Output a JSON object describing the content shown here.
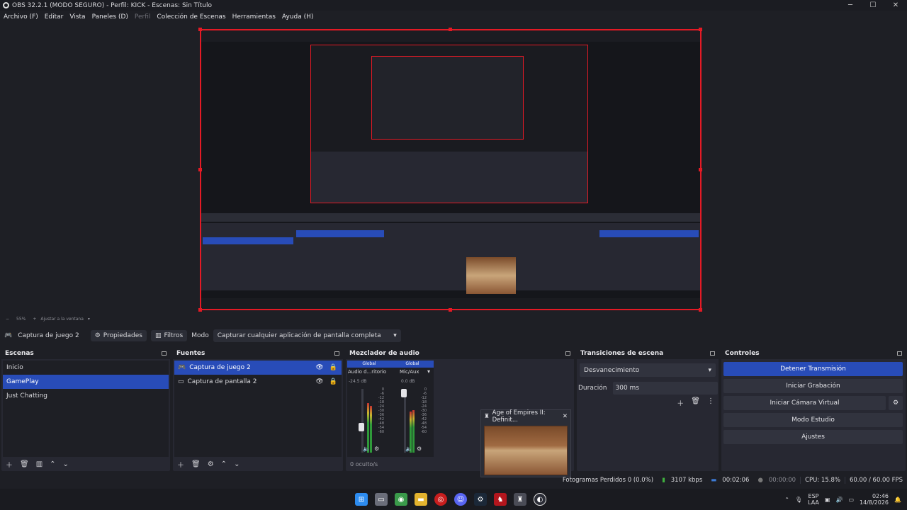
{
  "window": {
    "title": "OBS 32.2.1 (MODO SEGURO) - Perfil: KICK - Escenas: Sin Título",
    "minimize": "─",
    "maximize": "☐",
    "close": "✕"
  },
  "menu": [
    {
      "label": "Archivo (F)",
      "enabled": true
    },
    {
      "label": "Editar",
      "enabled": true
    },
    {
      "label": "Vista",
      "enabled": true
    },
    {
      "label": "Paneles (D)",
      "enabled": true
    },
    {
      "label": "Perfil",
      "enabled": false
    },
    {
      "label": "Colección de Escenas",
      "enabled": true
    },
    {
      "label": "Herramientas",
      "enabled": true
    },
    {
      "label": "Ayuda (H)",
      "enabled": true
    }
  ],
  "zoom": {
    "minus": "−",
    "value": "55%",
    "plus": "+",
    "fit": "Ajustar a la ventana"
  },
  "context": {
    "source_name": "Captura de juego 2",
    "properties": "Propiedades",
    "filters": "Filtros",
    "mode_label": "Modo",
    "mode_value": "Capturar cualquier aplicación de pantalla completa"
  },
  "scenes": {
    "title": "Escenas",
    "items": [
      {
        "label": "Inicio",
        "selected": false
      },
      {
        "label": "GamePlay",
        "selected": true
      },
      {
        "label": "Just Chatting",
        "selected": false
      }
    ]
  },
  "sources": {
    "title": "Fuentes",
    "items": [
      {
        "label": "Captura de juego 2",
        "selected": true
      },
      {
        "label": "Captura de pantalla 2",
        "selected": false
      }
    ]
  },
  "mixer": {
    "title": "Mezclador de audio",
    "channels": [
      {
        "tag": "Global",
        "name": "Audio d...ritorio",
        "db": "-24.5 dB",
        "level": 0.55
      },
      {
        "tag": "Global",
        "name": "Mic/Aux",
        "db": "0.0 dB",
        "level": 0.5
      }
    ],
    "ticks": [
      "0",
      "-6",
      "-12",
      "-18",
      "-24",
      "-30",
      "-36",
      "-42",
      "-48",
      "-54",
      "-60"
    ],
    "hidden": "0 oculto/s"
  },
  "thumbnail": {
    "title": "Age of Empires II: Definit..."
  },
  "transitions": {
    "title": "Transiciones de escena",
    "selected": "Desvanecimiento",
    "duration_label": "Duración",
    "duration_value": "300 ms"
  },
  "controls": {
    "title": "Controles",
    "buttons": [
      "Detener Transmisión",
      "Iniciar Grabación",
      "Iniciar Cámara Virtual",
      "Modo Estudio",
      "Ajustes"
    ]
  },
  "status": {
    "dropped": "Fotogramas Perdidos 0 (0.0%)",
    "bitrate": "3107 kbps",
    "stream_time": "00:02:06",
    "rec_time": "00:00:00",
    "cpu": "CPU: 15.8%",
    "fps": "60.00 / 60.00 FPS"
  },
  "taskbar": {
    "lang_top": "ESP",
    "lang_bottom": "LAA",
    "time": "02:46",
    "date": "14/8/2026"
  }
}
